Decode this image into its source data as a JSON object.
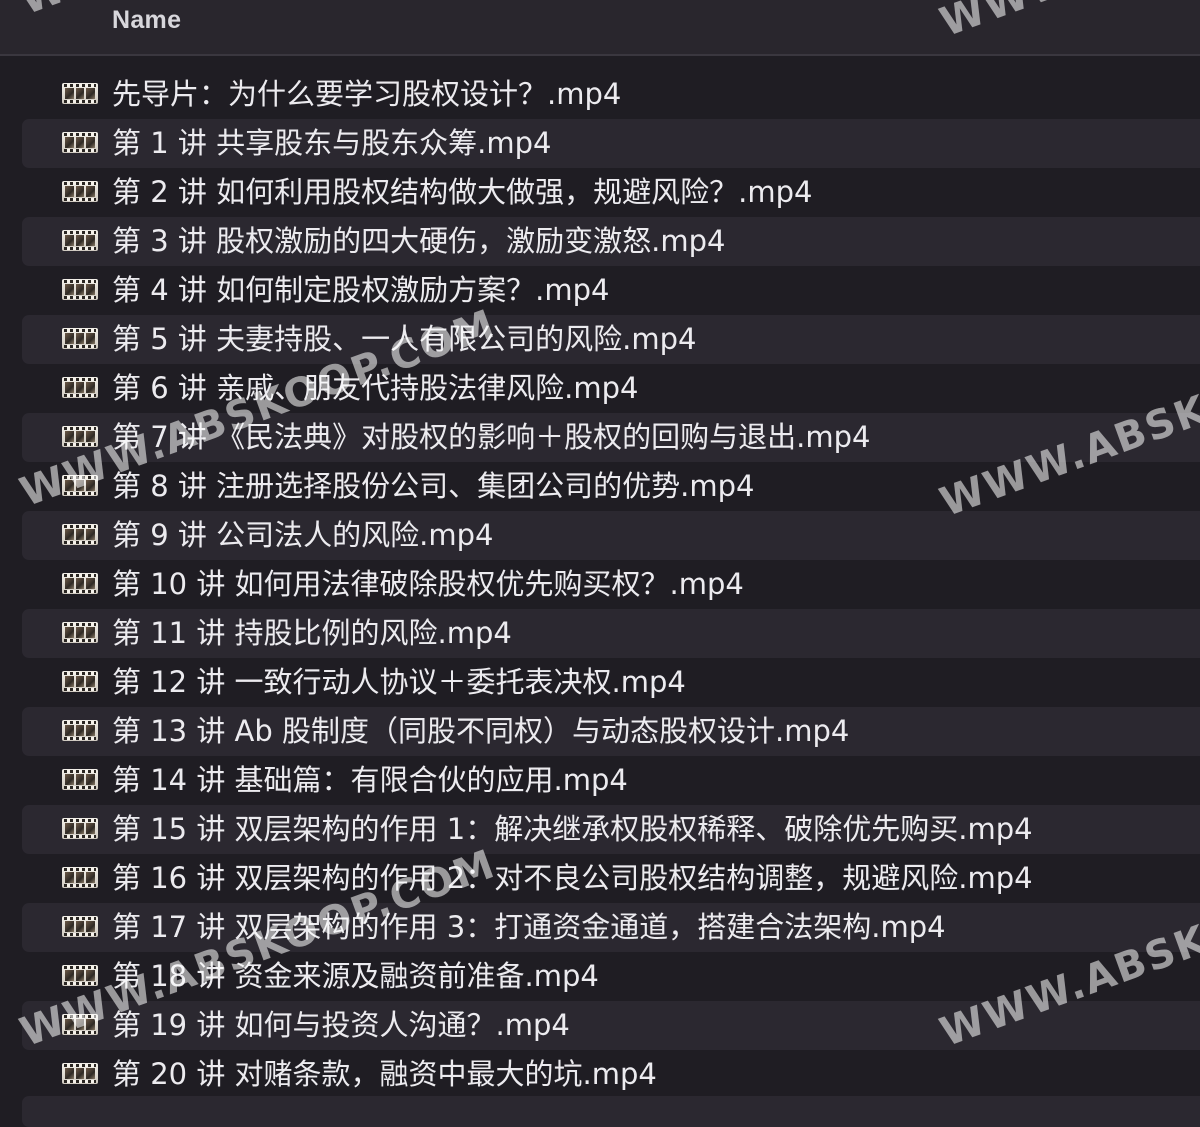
{
  "header": {
    "column_label": "Name"
  },
  "files": [
    {
      "name": "先导片：为什么要学习股权设计？.mp4",
      "icon": "video-file-icon"
    },
    {
      "name": "第 1 讲 共享股东与股东众筹.mp4",
      "icon": "video-file-icon"
    },
    {
      "name": "第 2 讲 如何利用股权结构做大做强，规避风险？.mp4",
      "icon": "video-file-icon"
    },
    {
      "name": "第 3 讲 股权激励的四大硬伤，激励变激怒.mp4",
      "icon": "video-file-icon"
    },
    {
      "name": "第 4 讲 如何制定股权激励方案？.mp4",
      "icon": "video-file-icon"
    },
    {
      "name": "第 5 讲 夫妻持股、一人有限公司的风险.mp4",
      "icon": "video-file-icon"
    },
    {
      "name": "第 6 讲 亲戚、朋友代持股法律风险.mp4",
      "icon": "video-file-icon"
    },
    {
      "name": "第 7 讲 《民法典》对股权的影响＋股权的回购与退出.mp4",
      "icon": "video-file-icon"
    },
    {
      "name": "第 8 讲 注册选择股份公司、集团公司的优势.mp4",
      "icon": "video-file-icon"
    },
    {
      "name": "第 9 讲 公司法人的风险.mp4",
      "icon": "video-file-icon"
    },
    {
      "name": "第 10 讲 如何用法律破除股权优先购买权？.mp4",
      "icon": "video-file-icon"
    },
    {
      "name": "第 11 讲 持股比例的风险.mp4",
      "icon": "video-file-icon"
    },
    {
      "name": "第 12 讲 一致行动人协议＋委托表决权.mp4",
      "icon": "video-file-icon"
    },
    {
      "name": "第 13 讲 Ab 股制度（同股不同权）与动态股权设计.mp4",
      "icon": "video-file-icon"
    },
    {
      "name": "第 14 讲 基础篇：有限合伙的应用.mp4",
      "icon": "video-file-icon"
    },
    {
      "name": "第 15 讲 双层架构的作用 1：解决继承权股权稀释、破除优先购买.mp4",
      "icon": "video-file-icon"
    },
    {
      "name": "第 16 讲 双层架构的作用 2：对不良公司股权结构调整，规避风险.mp4",
      "icon": "video-file-icon"
    },
    {
      "name": "第 17 讲 双层架构的作用 3：打通资金通道，搭建合法架构.mp4",
      "icon": "video-file-icon"
    },
    {
      "name": "第 18 讲 资金来源及融资前准备.mp4",
      "icon": "video-file-icon"
    },
    {
      "name": "第 19 讲 如何与投资人沟通？.mp4",
      "icon": "video-file-icon"
    },
    {
      "name": "第 20 讲 对赌条款，融资中最大的坑.mp4",
      "icon": "video-file-icon"
    }
  ],
  "watermark": {
    "text": "WWW.ABSKOOP.COM"
  }
}
